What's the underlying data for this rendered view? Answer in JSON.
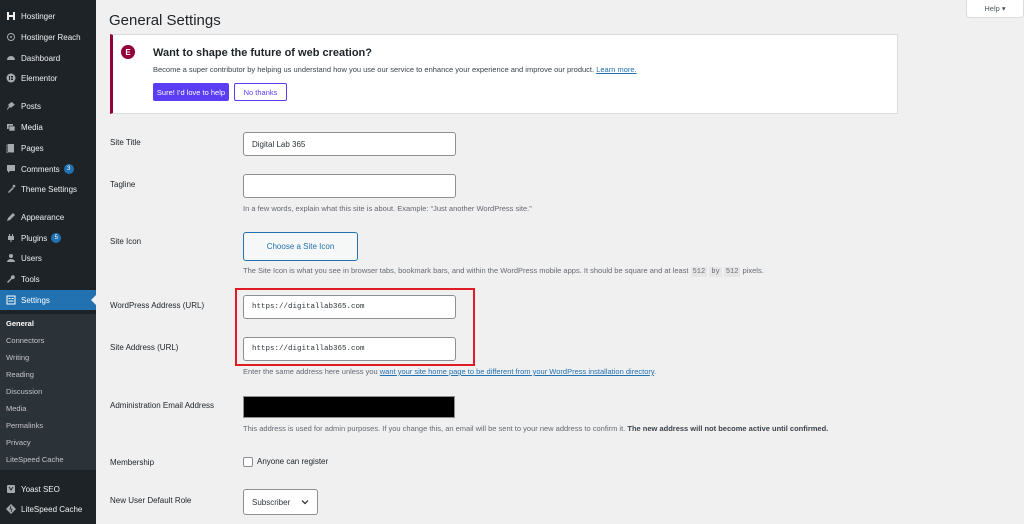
{
  "sidebar": {
    "items": [
      {
        "label": "Hostinger",
        "icon": "hostinger-icon"
      },
      {
        "label": "Hostinger Reach",
        "icon": "reach-icon"
      },
      {
        "label": "Dashboard",
        "icon": "dashboard-icon"
      },
      {
        "label": "Elementor",
        "icon": "elementor-icon"
      },
      {
        "label": "Posts",
        "icon": "pin-icon"
      },
      {
        "label": "Media",
        "icon": "media-icon"
      },
      {
        "label": "Pages",
        "icon": "pages-icon"
      },
      {
        "label": "Comments",
        "icon": "comments-icon",
        "badge": "3"
      },
      {
        "label": "Theme Settings",
        "icon": "theme-icon"
      },
      {
        "label": "Appearance",
        "icon": "appearance-icon"
      },
      {
        "label": "Plugins",
        "icon": "plugins-icon",
        "badge": "5"
      },
      {
        "label": "Users",
        "icon": "users-icon"
      },
      {
        "label": "Tools",
        "icon": "tools-icon"
      },
      {
        "label": "Settings",
        "icon": "settings-icon"
      }
    ],
    "submenu": [
      "General",
      "Connectors",
      "Writing",
      "Reading",
      "Discussion",
      "Media",
      "Permalinks",
      "Privacy",
      "LiteSpeed Cache"
    ],
    "bottom_items": [
      {
        "label": "Yoast SEO",
        "icon": "yoast-icon"
      },
      {
        "label": "LiteSpeed Cache",
        "icon": "litespeed-icon"
      }
    ]
  },
  "header": {
    "title": "General Settings",
    "help": "Help ▾"
  },
  "notice": {
    "logo": "E",
    "title": "Want to shape the future of web creation?",
    "text": "Become a super contributor by helping us understand how you use our service to enhance your experience and improve our product.",
    "link": "Learn more.",
    "primary_button": "Sure! I'd love to help",
    "secondary_button": "No thanks"
  },
  "form": {
    "site_title": {
      "label": "Site Title",
      "value": "Digital Lab 365"
    },
    "tagline": {
      "label": "Tagline",
      "value": "",
      "description": "In a few words, explain what this site is about. Example: “Just another WordPress site.”"
    },
    "site_icon": {
      "label": "Site Icon",
      "button": "Choose a Site Icon",
      "description_pre": "The Site Icon is what you see in browser tabs, bookmark bars, and within the WordPress mobile apps. It should be square and at least",
      "code1": "512",
      "by": "by",
      "code2": "512",
      "description_post": "pixels."
    },
    "wp_address": {
      "label": "WordPress Address (URL)",
      "value": "https://digitallab365.com"
    },
    "site_address": {
      "label": "Site Address (URL)",
      "value": "https://digitallab365.com",
      "description_pre": "Enter the same address here unless you",
      "link": "want your site home page to be different from your WordPress installation directory",
      "description_post": "."
    },
    "admin_email": {
      "label": "Administration Email Address",
      "description": "This address is used for admin purposes. If you change this, an email will be sent to your new address to confirm it.",
      "description_bold": "The new address will not become active until confirmed."
    },
    "membership": {
      "label": "Membership",
      "checkbox_label": "Anyone can register",
      "checked": false
    },
    "default_role": {
      "label": "New User Default Role",
      "value": "Subscriber"
    }
  }
}
